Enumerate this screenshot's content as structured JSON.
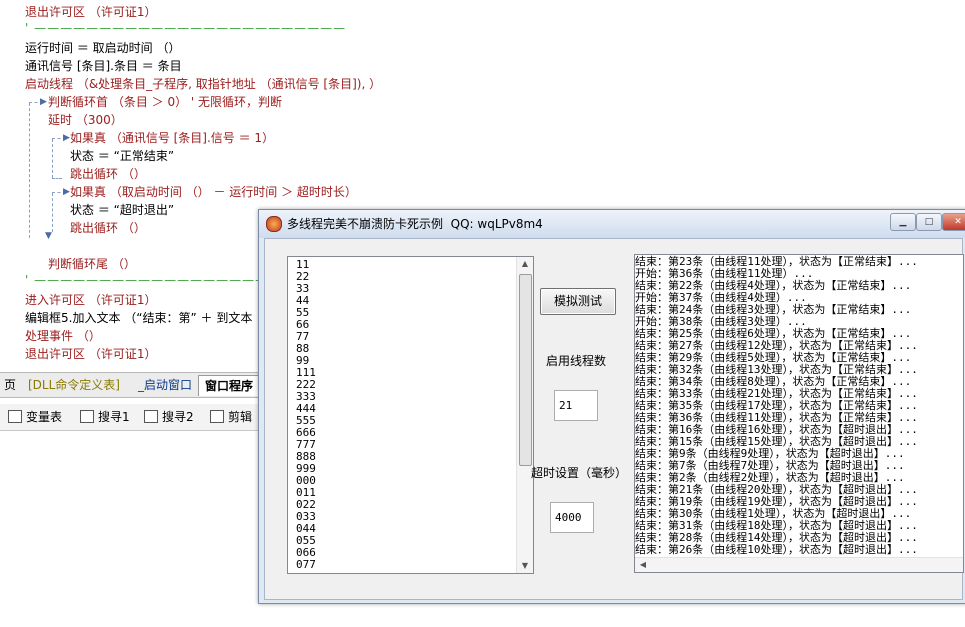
{
  "editor": {
    "lines": [
      {
        "text": "退出许可区 （许可证1）"
      },
      {
        "text": "运行时间 ＝ 取启动时间 （）"
      },
      {
        "text": "通讯信号 [条目].条目 ＝ 条目"
      },
      {
        "text": "启动线程 （&处理条目_子程序, 取指针地址 （通讯信号 [条目]), ）"
      },
      {
        "text": "判断循环首 （条目 ＞ 0） ' 无限循环，判断"
      },
      {
        "text": "延时 （300）"
      },
      {
        "text": "如果真 （通讯信号 [条目].信号 ＝ 1）"
      },
      {
        "text": "状态 ＝ “正常结束”"
      },
      {
        "text": "跳出循环 （）"
      },
      {
        "text": "如果真 （取启动时间 （） － 运行时间 ＞ 超时时长）"
      },
      {
        "text": "状态 ＝ “超时退出”"
      },
      {
        "text": "跳出循环 （）"
      },
      {
        "text": "判断循环尾 （）"
      },
      {
        "text": "进入许可区 （许可证1）"
      },
      {
        "text": "编辑框5.加入文本 （“结束：第” ＋ 到文本"
      },
      {
        "text": "处理事件 （）"
      },
      {
        "text": "退出许可区 （许可证1）"
      }
    ],
    "separator": "' ————————————————————————"
  },
  "tabs": [
    "页",
    "[DLL命令定义表]",
    "_启动窗口",
    "窗口程序"
  ],
  "toolbar": {
    "items": [
      {
        "label": "变量表",
        "icon": "variables-icon"
      },
      {
        "label": "搜寻1",
        "icon": "search-icon"
      },
      {
        "label": "搜寻2",
        "icon": "search-icon"
      },
      {
        "label": "剪辑",
        "icon": "clipboard-icon"
      }
    ]
  },
  "dialog": {
    "title": "多线程完美不崩溃防卡死示例",
    "qq": "QQ: wqLPv8m4",
    "list_items": [
      "11",
      "22",
      "33",
      "44",
      "55",
      "66",
      "77",
      "88",
      "99",
      "111",
      "222",
      "333",
      "444",
      "555",
      "666",
      "777",
      "888",
      "999",
      "000",
      "011",
      "022",
      "033",
      "044",
      "055",
      "066",
      "077"
    ],
    "simulate_button": "模拟测试",
    "threads_label": "启用线程数",
    "threads_value": "21",
    "timeout_label": "超时设置（毫秒）",
    "timeout_value": "4000",
    "log_lines": [
      "结束：第23条（由线程11处理），状态为【正常结束】...",
      "开始：第36条（由线程11处理）...",
      "结束：第22条（由线程4处理），状态为【正常结束】...",
      "开始：第37条（由线程4处理）...",
      "结束：第24条（由线程3处理），状态为【正常结束】...",
      "开始：第38条（由线程3处理）...",
      "结束：第25条（由线程6处理），状态为【正常结束】...",
      "结束：第27条（由线程12处理），状态为【正常结束】...",
      "结束：第29条（由线程5处理），状态为【正常结束】...",
      "结束：第32条（由线程13处理），状态为【正常结束】...",
      "结束：第34条（由线程8处理），状态为【正常结束】...",
      "结束：第33条（由线程21处理），状态为【正常结束】...",
      "结束：第35条（由线程17处理），状态为【正常结束】...",
      "结束：第36条（由线程11处理），状态为【正常结束】...",
      "结束：第16条（由线程16处理），状态为【超时退出】...",
      "结束：第15条（由线程15处理），状态为【超时退出】...",
      "结束：第9条（由线程9处理），状态为【超时退出】...",
      "结束：第7条（由线程7处理），状态为【超时退出】...",
      "结束：第2条（由线程2处理），状态为【超时退出】...",
      "结束：第21条（由线程20处理），状态为【超时退出】...",
      "结束：第19条（由线程19处理），状态为【超时退出】...",
      "结束：第30条（由线程1处理），状态为【超时退出】...",
      "结束：第31条（由线程18处理），状态为【超时退出】...",
      "结束：第28条（由线程14处理），状态为【超时退出】...",
      "结束：第26条（由线程10处理），状态为【超时退出】..."
    ]
  }
}
